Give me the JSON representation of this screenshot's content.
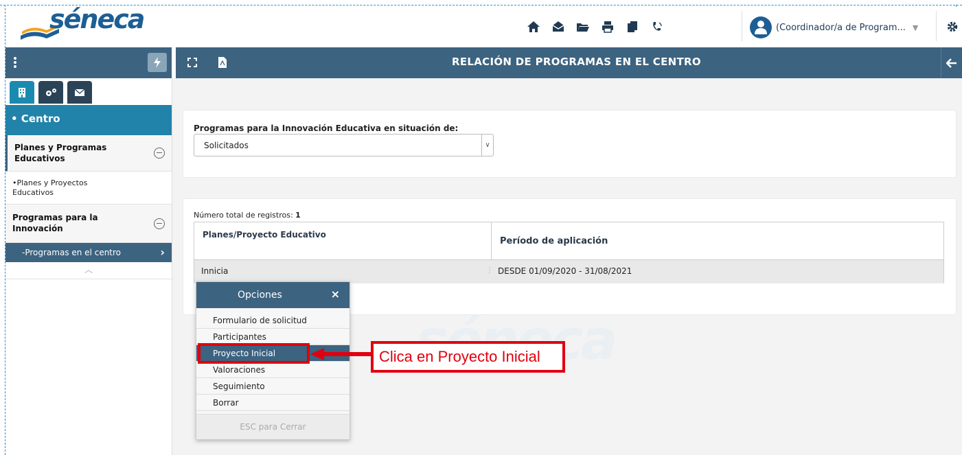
{
  "header": {
    "logo_text": "séneca",
    "icons": [
      "home-icon",
      "mail-icon",
      "folder-icon",
      "print-icon",
      "copy-icon",
      "phone-icon"
    ],
    "user_label": "(Coordinador/a de Program...",
    "settings_icon": "gear-icon"
  },
  "titlebar": {
    "title": "RELACIÓN DE PROGRAMAS EN EL CENTRO"
  },
  "sidebar": {
    "section": "• Centro",
    "group1_title": "Planes y Programas Educativos",
    "group1_item": "•Planes y Proyectos Educativos",
    "group2_title": "Programas para la Innovación",
    "active_item": "-Programas en el centro"
  },
  "filter": {
    "label": "Programas para la Innovación Educativa en situación de:",
    "selected": "Solicitados"
  },
  "table": {
    "count_label": "Número total de registros:",
    "count_value": "1",
    "headers": [
      "Planes/Proyecto Educativo",
      "Período de aplicación"
    ],
    "rows": [
      [
        "Innicia",
        "DESDE 01/09/2020 - 31/08/2021"
      ]
    ]
  },
  "popup": {
    "title": "Opciones",
    "items": [
      "Formulario de solicitud",
      "Participantes",
      "Proyecto Inicial",
      "Valoraciones",
      "Seguimiento",
      "Borrar"
    ],
    "footer": "ESC para Cerrar"
  },
  "annotation": {
    "text": "Clica en Proyecto Inicial",
    "color": "#e0000f"
  },
  "colors": {
    "brand_dark": "#3c6380",
    "brand_accent": "#2183a9",
    "logo": "#1d5f95"
  }
}
